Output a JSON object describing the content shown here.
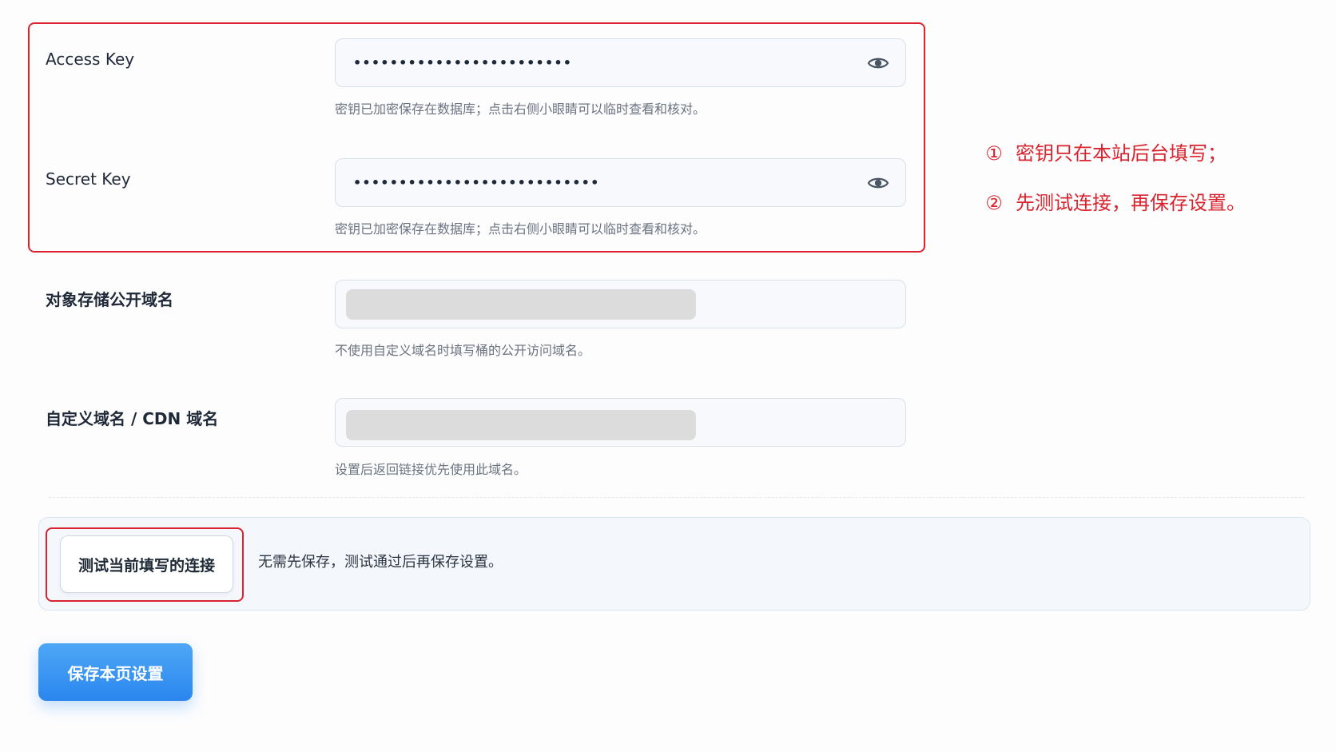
{
  "fields": [
    {
      "label": "Access Key",
      "masked_value": "••••••••••••••••••••••••",
      "hint": "密钥已加密保存在数据库；点击右侧小眼睛可以临时查看和核对。",
      "icon": "eye-icon"
    },
    {
      "label": "Secret Key",
      "masked_value": "•••••••••••••••••••••••••••",
      "hint": "密钥已加密保存在数据库；点击右侧小眼睛可以临时查看和核对。",
      "icon": "eye-icon"
    },
    {
      "label": "对象存储公开域名",
      "hint": "不使用自定义域名时填写桶的公开访问域名。"
    },
    {
      "label": "自定义域名 / CDN 域名",
      "hint": "设置后返回链接优先使用此域名。"
    }
  ],
  "test": {
    "button_label": "测试当前填写的连接",
    "note": "无需先保存，测试通过后再保存设置。"
  },
  "save_label": "保存本页设置",
  "annotations": [
    {
      "num": "①",
      "text": "密钥只在本站后台填写；"
    },
    {
      "num": "②",
      "text": "先测试连接，再保存设置。"
    }
  ],
  "colors": {
    "annotation_red": "#d9232e",
    "primary_blue": "#2f8ff0",
    "input_bg": "#f7f9fc",
    "hint_gray": "#6b7380"
  }
}
